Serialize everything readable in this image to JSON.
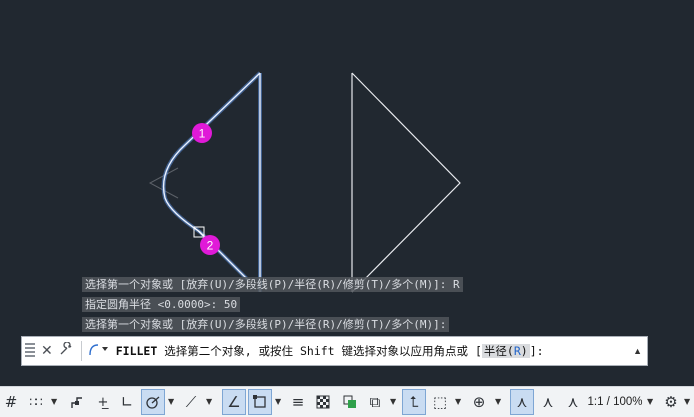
{
  "history": [
    "选择第一个对象或 [放弃(U)/多段线(P)/半径(R)/修剪(T)/多个(M)]: R",
    "指定圆角半径 <0.0000>: 50",
    "选择第一个对象或 [放弃(U)/多段线(P)/半径(R)/修剪(T)/多个(M)]:"
  ],
  "command": {
    "name": "FILLET",
    "prompt": " 选择第二个对象, 或按住 Shift 键选择对象以应用角点或 [",
    "option_label": "半径",
    "option_open": "(",
    "option_key": "R",
    "option_close": ")",
    "suffix": "]:"
  },
  "markers": [
    "1",
    "2"
  ],
  "status": {
    "scale": "1:1 / 100%"
  },
  "colors": {
    "background": "#212830",
    "marker": "#e01ad8",
    "highlight": "#7fb2ff",
    "line": "#e8eaee"
  }
}
